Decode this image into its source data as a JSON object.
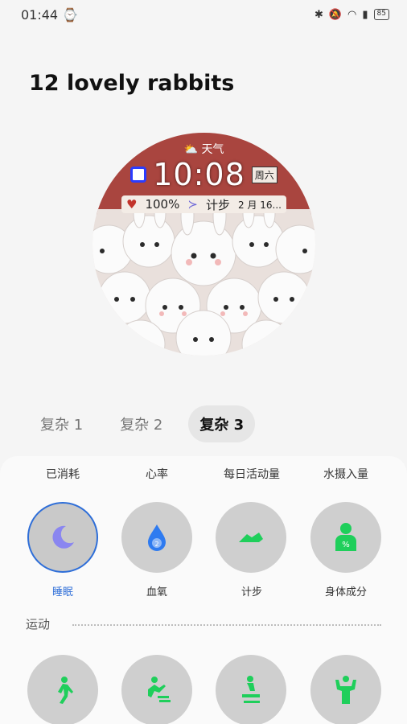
{
  "status_bar": {
    "time": "01:44",
    "battery": "85"
  },
  "page": {
    "title": "12 lovely rabbits"
  },
  "watchface": {
    "weather_label": "天气",
    "time": "10:08",
    "day": "周六",
    "battery_pct": "100%",
    "steps_label": "计步",
    "date": "2 月 16..."
  },
  "tabs": [
    {
      "label": "复杂 1"
    },
    {
      "label": "复杂 2"
    },
    {
      "label": "复杂 3"
    }
  ],
  "top_labels": [
    "已消耗",
    "心率",
    "每日活动量",
    "水摄入量"
  ],
  "complications": [
    {
      "label": "睡眠",
      "icon": "moon-icon",
      "selected": true
    },
    {
      "label": "血氧",
      "icon": "blood-oxygen-icon",
      "selected": false
    },
    {
      "label": "计步",
      "icon": "shoe-icon",
      "selected": false
    },
    {
      "label": "身体成分",
      "icon": "body-composition-icon",
      "selected": false
    }
  ],
  "section": {
    "title": "运动"
  },
  "exercise_icons": [
    "walk-icon",
    "running-machine-icon",
    "bike-icon",
    "strength-icon"
  ],
  "colors": {
    "accent": "#2e6ed8",
    "icon_green": "#1fcf5b",
    "watch_red": "#a9453f"
  }
}
